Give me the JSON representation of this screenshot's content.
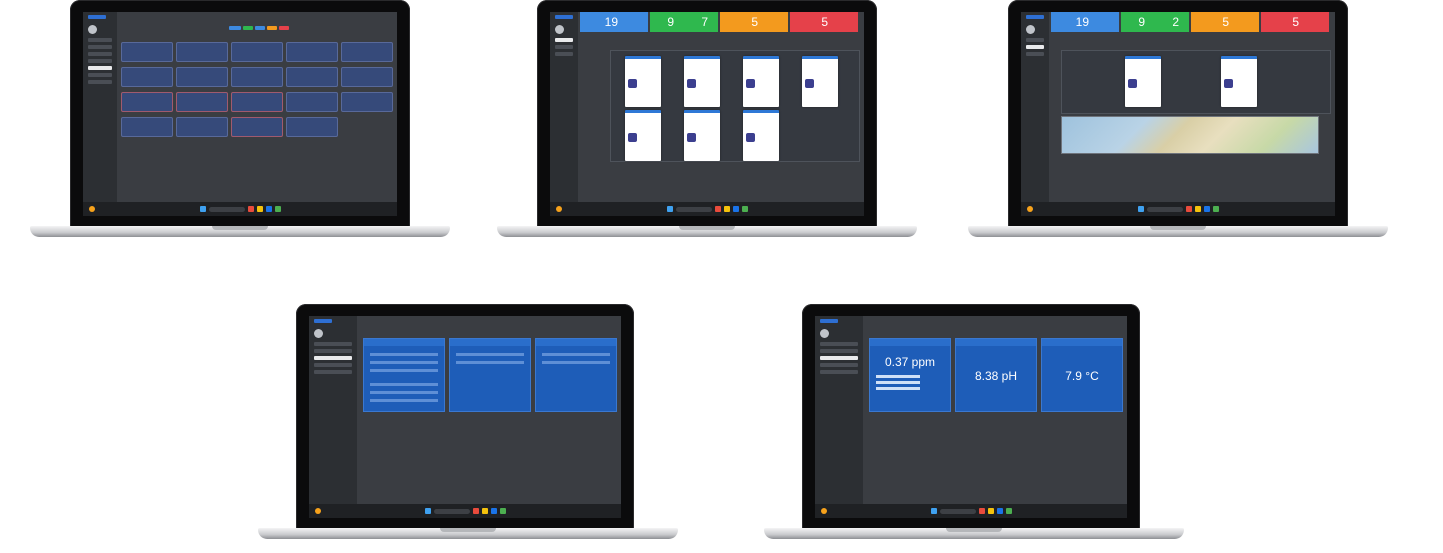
{
  "screens": {
    "overview_counts": [
      "19",
      "9",
      "7",
      "5",
      "5"
    ],
    "overview_counts_alt": [
      "19",
      "9",
      "2",
      "5",
      "5"
    ],
    "readings": [
      "0.37 ppm",
      "8.38 pH",
      "7.9 °C"
    ]
  },
  "colors": {
    "stat_blue": "#3d8ae0",
    "stat_green": "#2fb84e",
    "stat_orange": "#f39a1e",
    "stat_red": "#e5414a",
    "panel_blue": "#1e5db8",
    "screen_bg": "#3a3d42"
  },
  "icons": [
    "windows-start-icon",
    "search-icon",
    "avatar-icon",
    "weather-icon"
  ]
}
